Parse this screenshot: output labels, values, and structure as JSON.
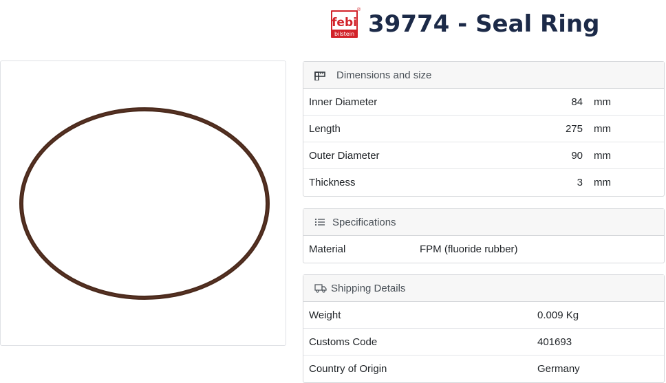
{
  "brand": {
    "logo_text": "febi",
    "logo_subtext": "bilstein",
    "logo_registered": "®",
    "logo_color": "#d2232a"
  },
  "product": {
    "title": "39774 - Seal Ring"
  },
  "image": {
    "subject": "seal-ring-photo",
    "ring_color": "#4a2a1c"
  },
  "dimensions": {
    "header": "Dimensions and size",
    "icon": "ruler-icon",
    "rows": [
      {
        "label": "Inner Diameter",
        "value": "84",
        "unit": "mm"
      },
      {
        "label": "Length",
        "value": "275",
        "unit": "mm"
      },
      {
        "label": "Outer Diameter",
        "value": "90",
        "unit": "mm"
      },
      {
        "label": "Thickness",
        "value": "3",
        "unit": "mm"
      }
    ]
  },
  "specifications": {
    "header": "Specifications",
    "icon": "list-icon",
    "rows": [
      {
        "label": "Material",
        "value": "FPM (fluoride rubber)"
      }
    ]
  },
  "shipping": {
    "header": "Shipping Details",
    "icon": "truck-icon",
    "rows": [
      {
        "label": "Weight",
        "value": "0.009 Kg"
      },
      {
        "label": "Customs Code",
        "value": "401693"
      },
      {
        "label": "Country of Origin",
        "value": "Germany"
      }
    ]
  }
}
